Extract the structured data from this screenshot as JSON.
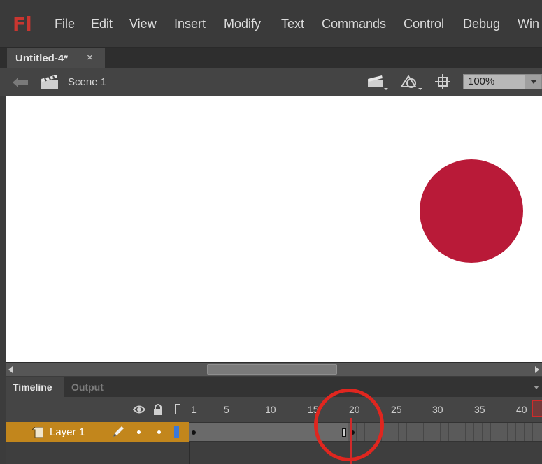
{
  "app": {
    "logo": "Fl"
  },
  "menu": [
    "File",
    "Edit",
    "View",
    "Insert",
    "Modify",
    "Text",
    "Commands",
    "Control",
    "Debug",
    "Win"
  ],
  "document_tab": {
    "title": "Untitled-4*",
    "close": "×"
  },
  "edit_bar": {
    "scene": "Scene 1",
    "zoom": "100%"
  },
  "stage": {
    "circle_color": "#b91a38",
    "background": "#ffffff"
  },
  "panel_tabs": {
    "active": "Timeline",
    "inactive": "Output"
  },
  "timeline": {
    "frame_numbers": [
      "1",
      "5",
      "10",
      "15",
      "20",
      "25",
      "30",
      "35",
      "40"
    ],
    "current_frame": 20,
    "layer": {
      "name": "Layer 1",
      "color": "#3a78d8",
      "highlight": "#c2861c"
    }
  },
  "accent": {
    "annotation": "#e0261f",
    "playhead": "#d12a2a"
  }
}
